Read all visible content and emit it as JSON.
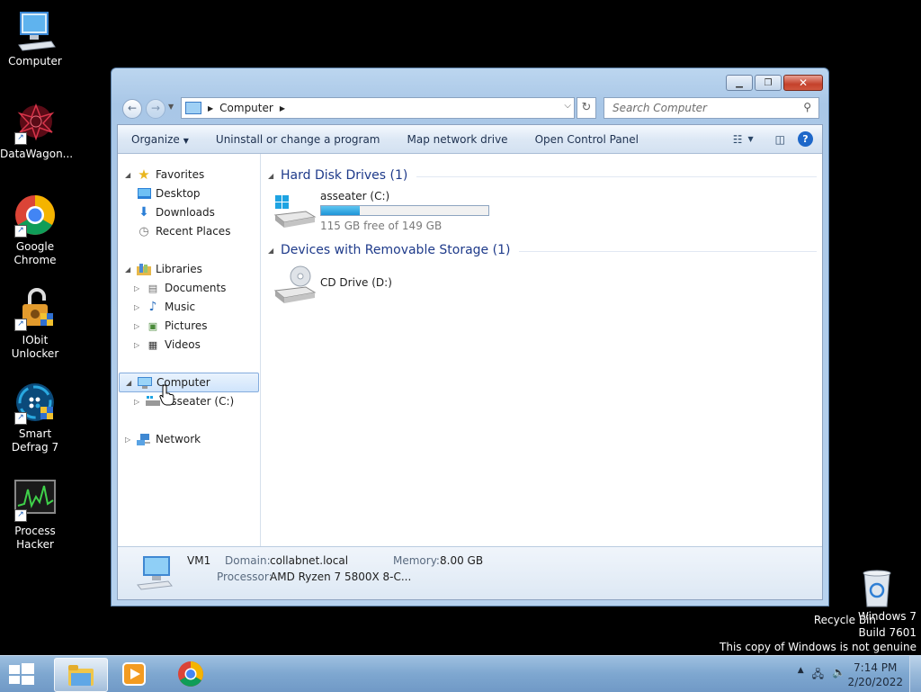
{
  "desktop": {
    "icons": [
      {
        "label": "Computer",
        "icon": "computer-icon"
      },
      {
        "label": "DataWagon...",
        "icon": "datawagon-icon"
      },
      {
        "label": "Google Chrome",
        "icon": "chrome-icon"
      },
      {
        "label": "IObit Unlocker",
        "icon": "iobit-unlocker-icon"
      },
      {
        "label": "Smart Defrag 7",
        "icon": "smart-defrag-icon"
      },
      {
        "label": "Process Hacker",
        "icon": "process-hacker-icon"
      }
    ],
    "recycle_bin": "Recycle Bin",
    "watermark": [
      "Windows 7",
      "Build 7601",
      "This copy of Windows is not genuine"
    ]
  },
  "explorer": {
    "address_crumb": "Computer",
    "search_placeholder": "Search Computer",
    "commands": [
      "Organize",
      "Uninstall or change a program",
      "Map network drive",
      "Open Control Panel"
    ],
    "nav": {
      "favorites": "Favorites",
      "desktop": "Desktop",
      "downloads": "Downloads",
      "recent": "Recent Places",
      "libraries": "Libraries",
      "documents": "Documents",
      "music": "Music",
      "pictures": "Pictures",
      "videos": "Videos",
      "computer": "Computer",
      "drive_c": "asseater (C:)",
      "network": "Network"
    },
    "groups": {
      "hdd": "Hard Disk Drives (1)",
      "removable": "Devices with Removable Storage (1)"
    },
    "drive_c": {
      "name": "asseater (C:)",
      "free_text": "115 GB free of 149 GB",
      "used_fraction": 0.23
    },
    "drive_d": {
      "name": "CD Drive (D:)"
    },
    "details": {
      "name": "VM1",
      "domain_label": "Domain:",
      "domain": "collabnet.local",
      "memory_label": "Memory:",
      "memory": "8.00 GB",
      "processor_label": "Processor:",
      "processor": "AMD Ryzen 7 5800X 8-C..."
    }
  },
  "taskbar": {
    "time": "7:14 PM",
    "date": "2/20/2022",
    "tray_arrow": "▲",
    "colors": {
      "accent": "#1d67c9",
      "taskbar": "#7ea7d0"
    }
  }
}
